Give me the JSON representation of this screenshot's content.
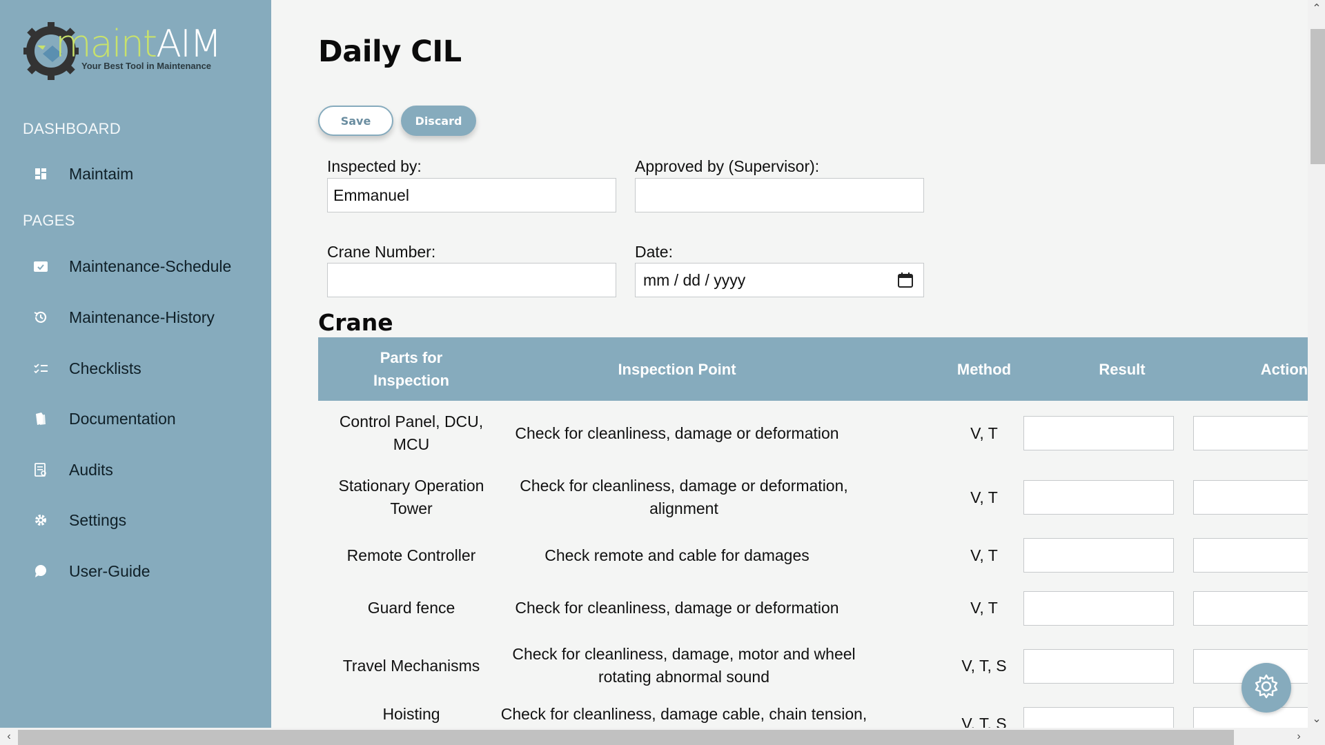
{
  "sidebar": {
    "logo": {
      "brand_maint": "maint",
      "brand_aim": "AIM",
      "tagline": "Your Best Tool in Maintenance"
    },
    "section_dashboard": "DASHBOARD",
    "section_pages": "PAGES",
    "items": [
      {
        "label": "Maintaim",
        "icon": "dashboard-icon"
      },
      {
        "label": "Maintenance-Schedule",
        "icon": "calendar-check-icon"
      },
      {
        "label": "Maintenance-History",
        "icon": "history-icon"
      },
      {
        "label": "Checklists",
        "icon": "checklist-icon"
      },
      {
        "label": "Documentation",
        "icon": "documents-icon"
      },
      {
        "label": "Audits",
        "icon": "audit-icon"
      },
      {
        "label": "Settings",
        "icon": "gear-icon"
      },
      {
        "label": "User-Guide",
        "icon": "chat-bubble-icon"
      }
    ]
  },
  "page": {
    "title": "Daily CIL",
    "save_label": "Save",
    "discard_label": "Discard"
  },
  "form": {
    "inspected_by_label": "Inspected by:",
    "inspected_by_value": "Emmanuel",
    "approved_by_label": "Approved by (Supervisor):",
    "approved_by_value": "",
    "crane_number_label": "Crane Number:",
    "crane_number_value": "",
    "date_label": "Date:",
    "date_placeholder": "mm / dd / yyyy"
  },
  "crane_section": {
    "title": "Crane",
    "headers": {
      "parts": "Parts for Inspection",
      "point": "Inspection Point",
      "method": "Method",
      "result": "Result",
      "action": "Action"
    },
    "rows": [
      {
        "part": "Control Panel, DCU, MCU",
        "point": "Check for cleanliness, damage or deformation",
        "method": "V, T"
      },
      {
        "part": "Stationary Operation Tower",
        "point": "Check for cleanliness, damage or deformation, alignment",
        "method": "V, T"
      },
      {
        "part": "Remote Controller",
        "point": "Check remote and cable for damages",
        "method": "V, T"
      },
      {
        "part": "Guard fence",
        "point": "Check for cleanliness, damage or deformation",
        "method": "V, T"
      },
      {
        "part": "Travel Mechanisms",
        "point": "Check for cleanliness, damage, motor and wheel rotating abnormal sound",
        "method": "V, T, S"
      },
      {
        "part": "Hoisting",
        "point": "Check for cleanliness, damage cable, chain tension,",
        "method": "V, T, S"
      }
    ]
  },
  "colors": {
    "sidebar_bg": "#86abbd",
    "accent": "#86abbd",
    "page_bg": "#f4f5f4",
    "logo_green": "#c8e26b"
  }
}
